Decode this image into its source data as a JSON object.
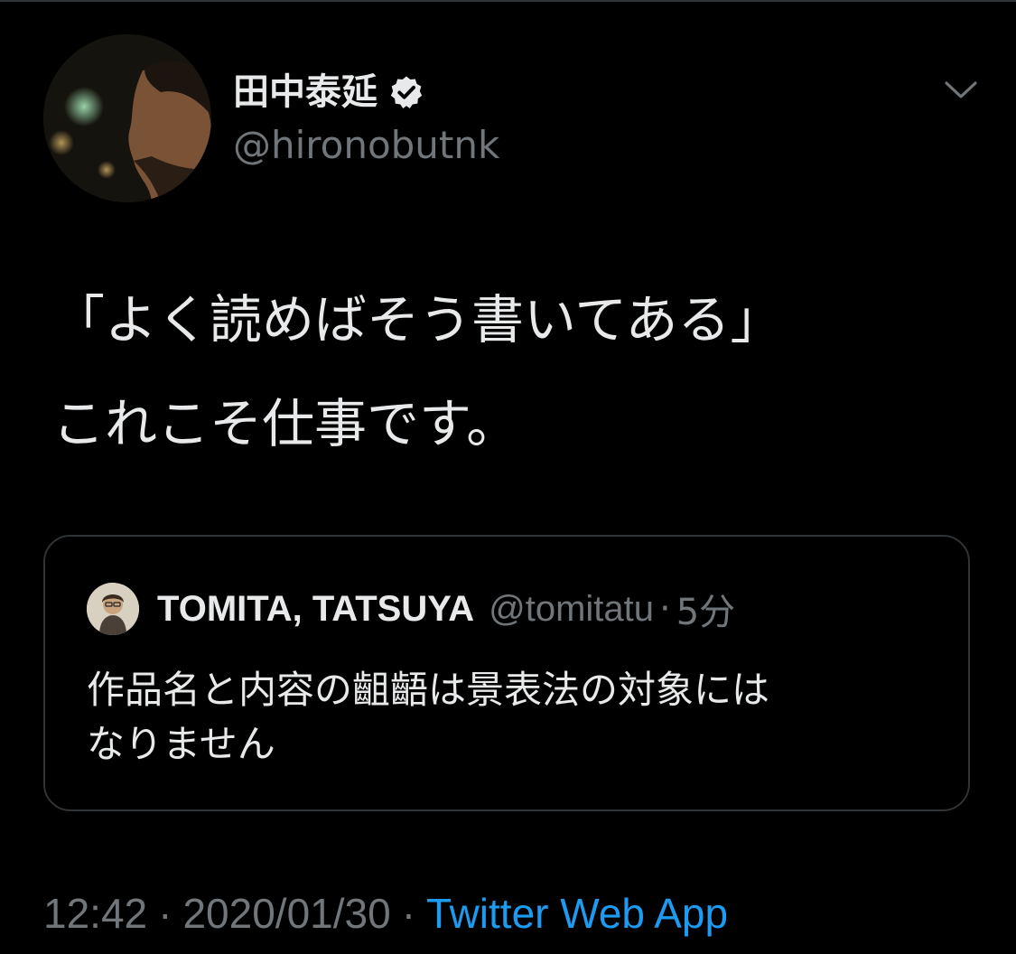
{
  "tweet": {
    "author": {
      "display_name": "田中泰延",
      "handle": "@hironobutnk",
      "verified": true
    },
    "text_lines": [
      "「よく読めばそう書いてある」",
      "これこそ仕事です。"
    ],
    "menu_icon": "chevron-down-icon"
  },
  "quoted_tweet": {
    "display_name": "TOMITA, TATSUYA",
    "handle": "@tomitatu",
    "separator": "·",
    "time": "5分",
    "text_lines": [
      "作品名と内容の齟齬は景表法の対象には",
      "なりません"
    ]
  },
  "meta": {
    "time": "12:42",
    "separator": "·",
    "date": "2020/01/30",
    "source": "Twitter Web App"
  },
  "colors": {
    "background": "#000000",
    "text": "#e7e9ea",
    "secondary": "#71767b",
    "accent": "#1d9bf0",
    "border": "#2f3336"
  }
}
